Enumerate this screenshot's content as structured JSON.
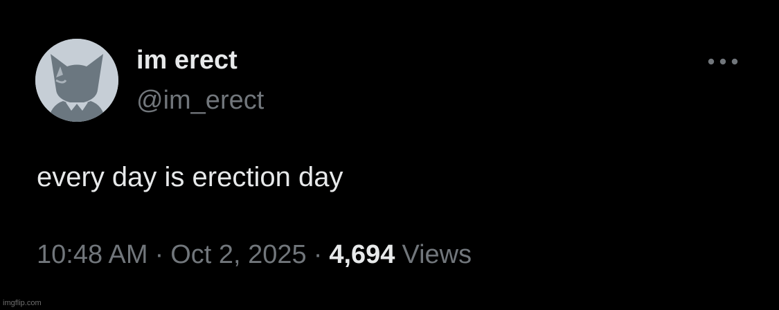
{
  "author": {
    "display_name": "im erect",
    "handle": "@im_erect",
    "avatar_icon": "fox-silhouette-avatar"
  },
  "tweet": {
    "text": "every day is erection day"
  },
  "meta": {
    "time": "10:48 AM",
    "separator": "·",
    "date": "Oct 2, 2025",
    "views_count": "4,694",
    "views_label": "Views"
  },
  "menu": {
    "more_icon": "more-options-icon"
  },
  "watermark": {
    "text": "imgflip.com"
  },
  "colors": {
    "background": "#000000",
    "primary_text": "#e7e9ea",
    "secondary_text": "#71767b",
    "avatar_bg": "#c6ced6",
    "avatar_figure": "#6b7780"
  }
}
